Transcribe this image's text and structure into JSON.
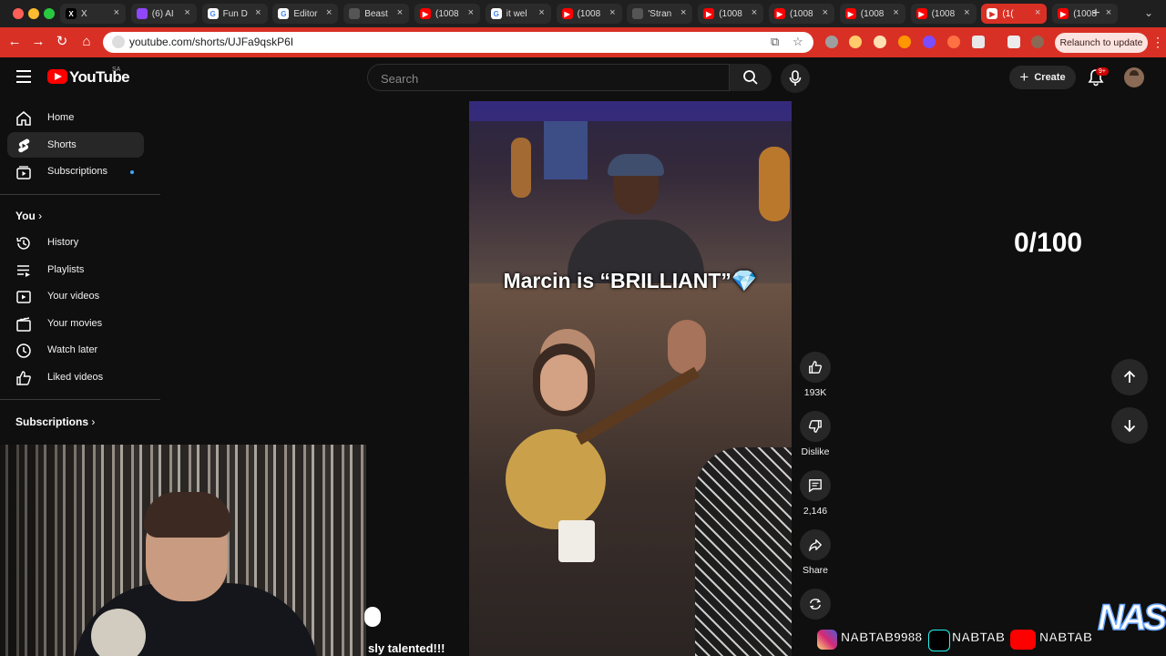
{
  "browser": {
    "tabs": [
      {
        "label": "X",
        "type": "x",
        "active": false
      },
      {
        "label": "(6) AI",
        "type": "twitch",
        "active": false
      },
      {
        "label": "Fun D",
        "type": "google",
        "active": false
      },
      {
        "label": "Editor",
        "type": "google",
        "active": false
      },
      {
        "label": "Beast",
        "type": "other",
        "active": false
      },
      {
        "label": "(1008",
        "type": "youtube",
        "active": false
      },
      {
        "label": "it wel",
        "type": "google",
        "active": false
      },
      {
        "label": "(1008",
        "type": "youtube",
        "active": false
      },
      {
        "label": "'Stran",
        "type": "other",
        "active": false
      },
      {
        "label": "(1008",
        "type": "youtube",
        "active": false
      },
      {
        "label": "(1008",
        "type": "youtube",
        "active": false
      },
      {
        "label": "(1008",
        "type": "youtube",
        "active": false
      },
      {
        "label": "(1008",
        "type": "youtube",
        "active": false
      },
      {
        "label": "(1(",
        "type": "youtube",
        "active": true
      },
      {
        "label": "(1008",
        "type": "youtube",
        "active": false
      }
    ],
    "url": "youtube.com/shorts/UJFa9qskP6I",
    "relaunch_label": "Relaunch to update",
    "accent": "#d93025"
  },
  "header": {
    "logo_text": "YouTube",
    "region": "SA",
    "search_placeholder": "Search",
    "create_label": "Create",
    "notification_badge": "9+"
  },
  "sidebar": {
    "items": [
      {
        "label": "Home",
        "icon": "home-icon"
      },
      {
        "label": "Shorts",
        "icon": "shorts-icon"
      },
      {
        "label": "Subscriptions",
        "icon": "subscriptions-icon"
      }
    ],
    "you_heading": "You",
    "you_items": [
      {
        "label": "History",
        "icon": "history-icon"
      },
      {
        "label": "Playlists",
        "icon": "playlists-icon"
      },
      {
        "label": "Your videos",
        "icon": "your-videos-icon"
      },
      {
        "label": "Your movies",
        "icon": "your-movies-icon"
      },
      {
        "label": "Watch later",
        "icon": "watch-later-icon"
      },
      {
        "label": "Liked videos",
        "icon": "liked-videos-icon"
      }
    ],
    "subscriptions_heading": "Subscriptions"
  },
  "short": {
    "caption": "Marcin is “BRILLIANT”",
    "caption_emoji": "💎",
    "likes": "193K",
    "dislike_label": "Dislike",
    "comments": "2,146",
    "share_label": "Share"
  },
  "overlay": {
    "score": "0/100",
    "subcaption": "sly talented!!!",
    "socials": [
      {
        "handle": "NABTAB9988",
        "icon": "instagram-icon"
      },
      {
        "handle": "NABTAB",
        "icon": "tiktok-icon"
      },
      {
        "handle": "NABTAB",
        "icon": "youtube-icon"
      }
    ],
    "watermark": "NAS"
  }
}
